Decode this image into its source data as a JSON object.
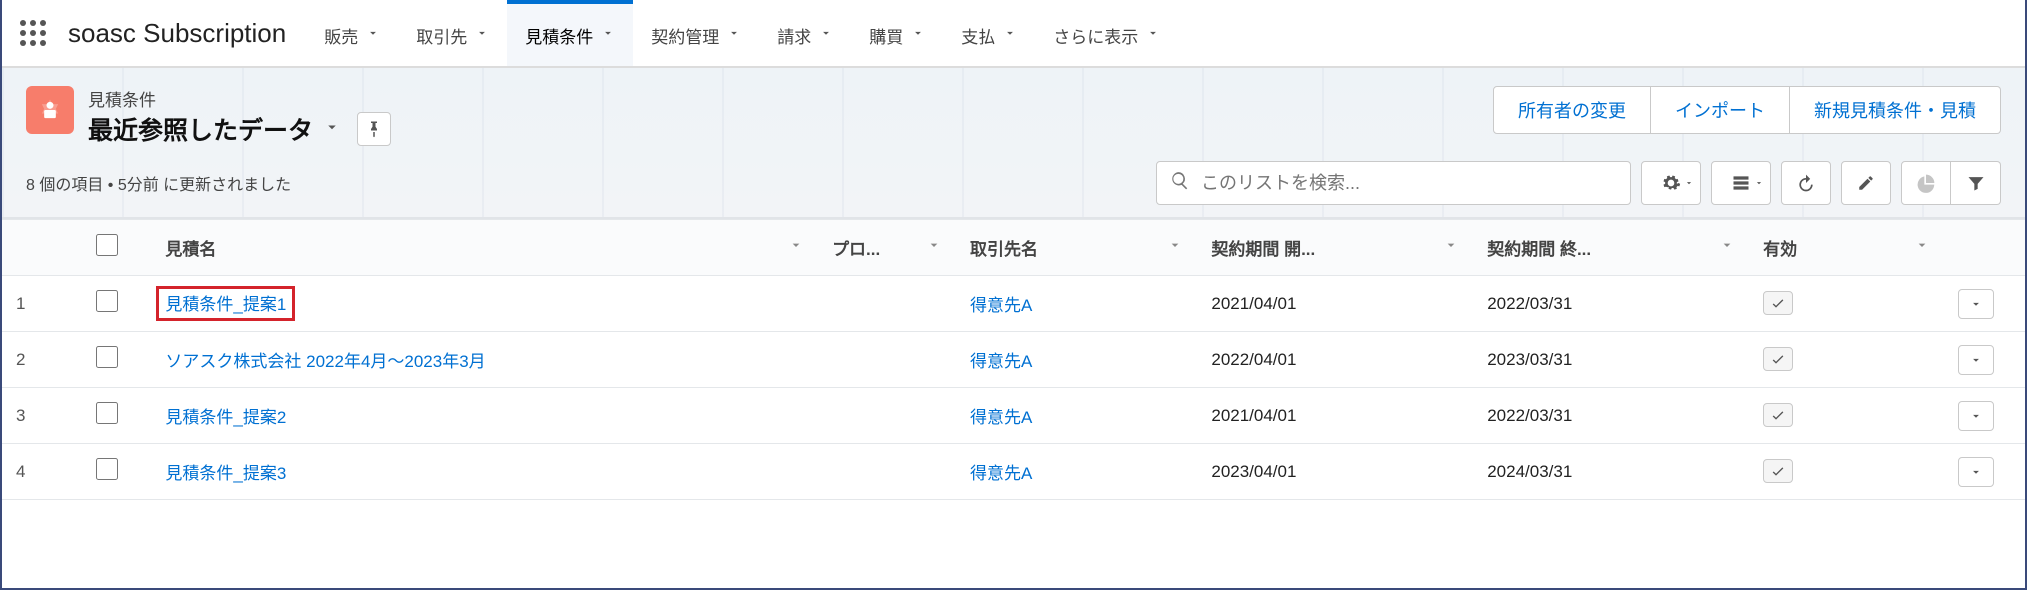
{
  "nav": {
    "app_name": "soasc Subscription",
    "items": [
      {
        "label": "販売"
      },
      {
        "label": "取引先"
      },
      {
        "label": "見積条件",
        "active": true
      },
      {
        "label": "契約管理"
      },
      {
        "label": "請求"
      },
      {
        "label": "購買"
      },
      {
        "label": "支払"
      }
    ],
    "more_label": "さらに表示"
  },
  "header": {
    "object_type": "見積条件",
    "list_view_title": "最近参照したデータ",
    "actions": {
      "change_owner": "所有者の変更",
      "import": "インポート",
      "new_quote": "新規見積条件・見積"
    },
    "status_text": "8 個の項目 • 5分前 に更新されました",
    "search_placeholder": "このリストを検索..."
  },
  "table": {
    "columns": {
      "name": "見積名",
      "pro": "プロ...",
      "account": "取引先名",
      "period_start": "契約期間 開...",
      "period_end": "契約期間 終...",
      "valid": "有効"
    },
    "rows": [
      {
        "num": "1",
        "name": "見積条件_提案1",
        "highlight": true,
        "account": "得意先A",
        "start": "2021/04/01",
        "end": "2022/03/31",
        "valid": true
      },
      {
        "num": "2",
        "name": "ソアスク株式会社 2022年4月～2023年3月",
        "highlight": false,
        "account": "得意先A",
        "start": "2022/04/01",
        "end": "2023/03/31",
        "valid": true
      },
      {
        "num": "3",
        "name": "見積条件_提案2",
        "highlight": false,
        "account": "得意先A",
        "start": "2021/04/01",
        "end": "2022/03/31",
        "valid": true
      },
      {
        "num": "4",
        "name": "見積条件_提案3",
        "highlight": false,
        "account": "得意先A",
        "start": "2023/04/01",
        "end": "2024/03/31",
        "valid": true
      }
    ]
  }
}
